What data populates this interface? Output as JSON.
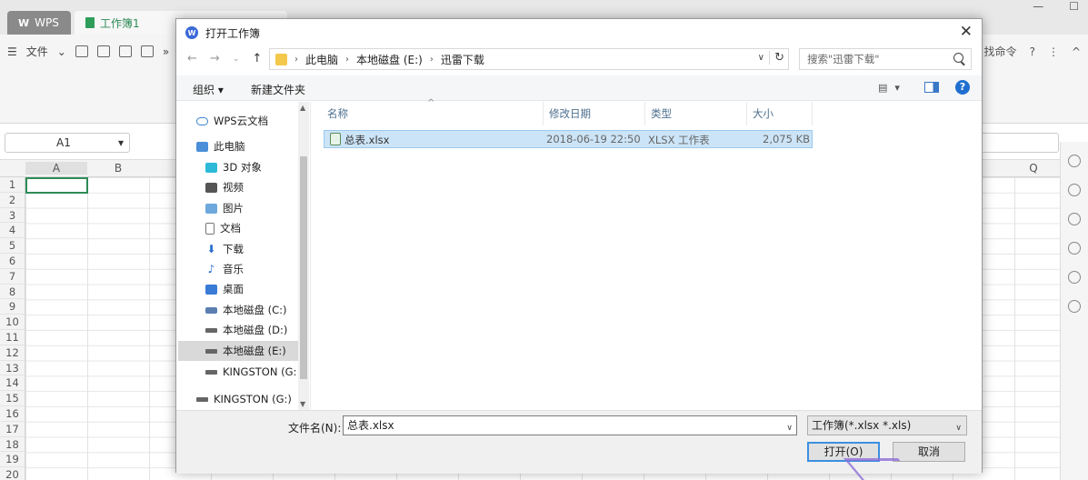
{
  "app": {
    "tabs": [
      {
        "label": "WPS"
      },
      {
        "label": "工作簿1"
      }
    ],
    "toolbar": {
      "file_menu": "文件",
      "find_command": "找命令"
    },
    "namebox": "A1",
    "columns": [
      "A",
      "B",
      "Q"
    ],
    "rows": [
      "1",
      "2",
      "3",
      "4",
      "5",
      "6",
      "7",
      "8",
      "9",
      "10",
      "11",
      "12",
      "13",
      "14",
      "15",
      "16",
      "17",
      "18",
      "19",
      "20"
    ]
  },
  "dialog": {
    "title": "打开工作簿",
    "breadcrumb": [
      "此电脑",
      "本地磁盘 (E:)",
      "迅雷下载"
    ],
    "search_placeholder": "搜索\"迅雷下载\"",
    "organize": "组织 ▾",
    "new_folder": "新建文件夹",
    "nav": [
      {
        "label": "WPS云文档",
        "icon": "cloud-icon"
      },
      {
        "label": "此电脑",
        "icon": "computer-icon"
      },
      {
        "label": "3D 对象",
        "icon": "cube-icon"
      },
      {
        "label": "视频",
        "icon": "video-icon"
      },
      {
        "label": "图片",
        "icon": "picture-icon"
      },
      {
        "label": "文档",
        "icon": "document-icon"
      },
      {
        "label": "下载",
        "icon": "download-icon"
      },
      {
        "label": "音乐",
        "icon": "music-icon"
      },
      {
        "label": "桌面",
        "icon": "desktop-icon"
      },
      {
        "label": "本地磁盘 (C:)",
        "icon": "drive-icon"
      },
      {
        "label": "本地磁盘 (D:)",
        "icon": "drive-icon"
      },
      {
        "label": "本地磁盘 (E:)",
        "icon": "drive-icon"
      },
      {
        "label": "KINGSTON (G:",
        "icon": "usb-drive-icon"
      },
      {
        "label": "KINGSTON (G:)",
        "icon": "usb-drive-icon"
      }
    ],
    "columns": [
      "名称",
      "修改日期",
      "类型",
      "大小"
    ],
    "files": [
      {
        "name": "总表.xlsx",
        "modified": "2018-06-19 22:50",
        "type": "XLSX 工作表",
        "size": "2,075 KB"
      }
    ],
    "filename_label": "文件名(N):",
    "filename_value": "总表.xlsx",
    "filetype_value": "工作簿(*.xlsx *.xls)",
    "open_button": "打开(O)",
    "cancel_button": "取消"
  }
}
